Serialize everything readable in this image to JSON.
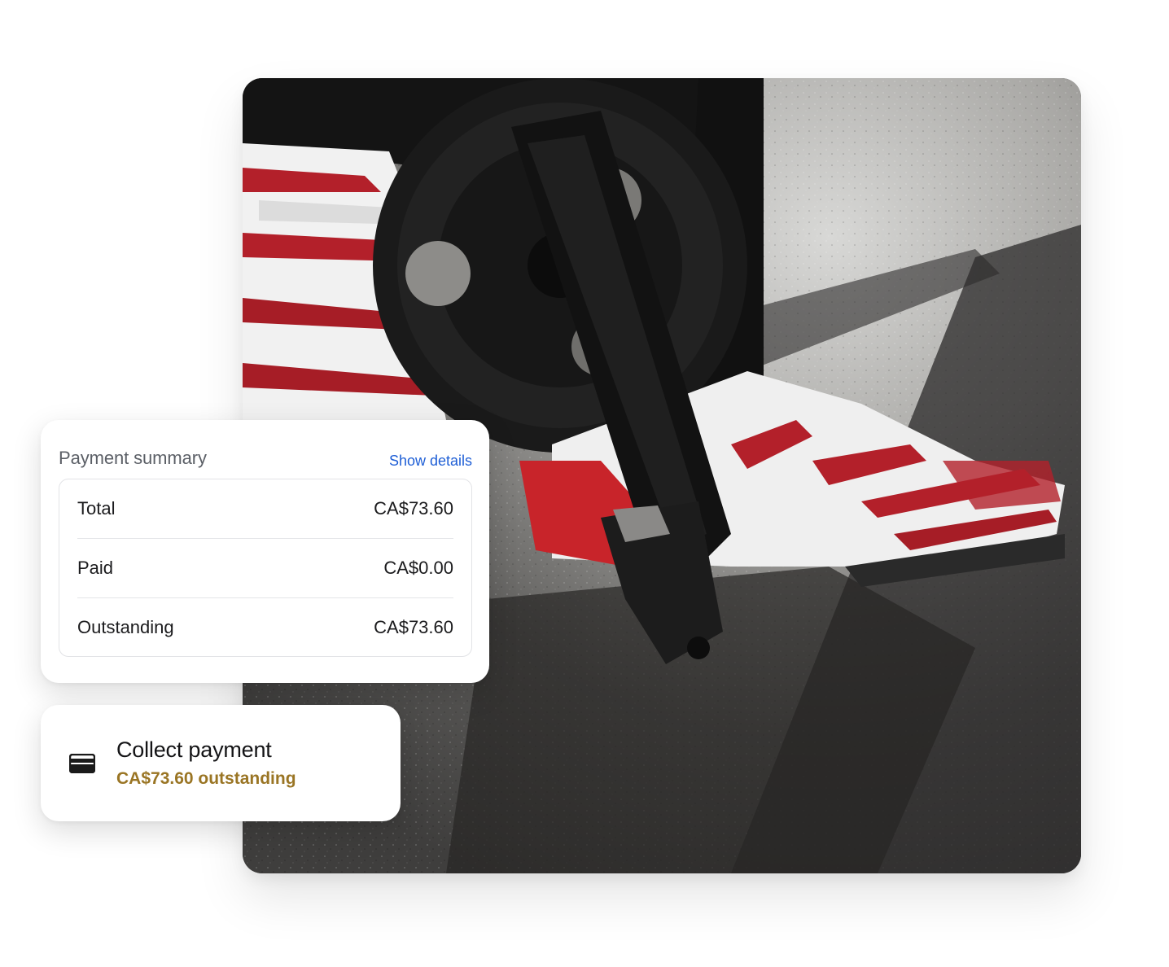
{
  "photo": {
    "icon": "bicycle-pedal-photo"
  },
  "payment_summary": {
    "title": "Payment summary",
    "link_label": "Show details",
    "rows": [
      {
        "label": "Total",
        "value": "CA$73.60"
      },
      {
        "label": "Paid",
        "value": "CA$0.00"
      },
      {
        "label": "Outstanding",
        "value": "CA$73.60"
      }
    ]
  },
  "collect_payment": {
    "icon": "credit-card-icon",
    "title": "Collect payment",
    "subtitle": "CA$73.60 outstanding",
    "subtitle_color": "#9a7524"
  },
  "colors": {
    "link": "#1f5fd6",
    "text": "#1b1b1d",
    "muted": "#5b5f66",
    "accent_gold": "#9a7524"
  }
}
